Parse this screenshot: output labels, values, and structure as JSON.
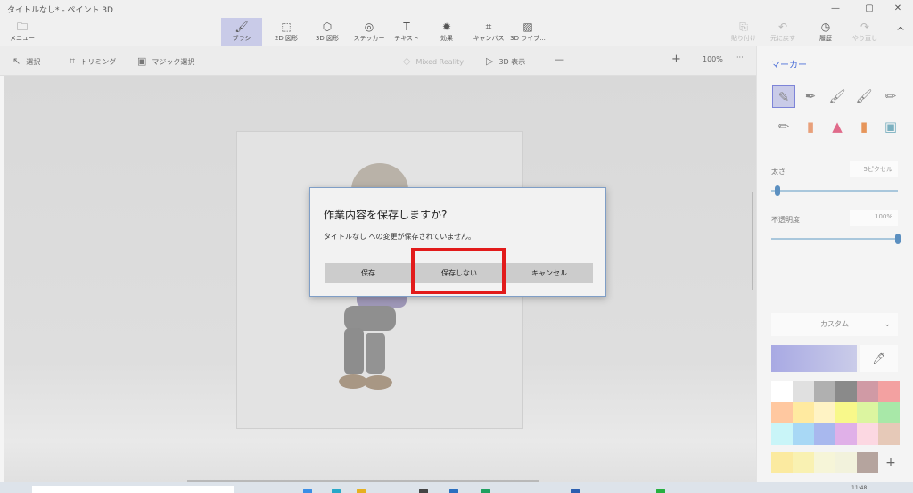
{
  "window": {
    "title": "タイトルなし* - ペイント 3D",
    "minimize": "—",
    "maximize": "▢",
    "close": "✕"
  },
  "ribbon": {
    "menu": {
      "label": "メニュー",
      "icon": "folder-icon"
    },
    "tools": [
      {
        "label": "ブラシ",
        "icon": "brush-icon",
        "active": true
      },
      {
        "label": "2D 図形",
        "icon": "2d-shapes-icon"
      },
      {
        "label": "3D 図形",
        "icon": "3d-shapes-icon"
      },
      {
        "label": "ステッカー",
        "icon": "sticker-icon"
      },
      {
        "label": "テキスト",
        "icon": "text-icon"
      },
      {
        "label": "効果",
        "icon": "effects-icon"
      },
      {
        "label": "キャンバス",
        "icon": "canvas-icon"
      },
      {
        "label": "3D ライブ...",
        "icon": "3d-library-icon"
      }
    ],
    "right": [
      {
        "label": "貼り付け",
        "icon": "paste-icon",
        "enabled": false
      },
      {
        "label": "元に戻す",
        "icon": "undo-icon",
        "enabled": false
      },
      {
        "label": "履歴",
        "icon": "history-icon",
        "enabled": true
      },
      {
        "label": "やり直し",
        "icon": "redo-icon",
        "enabled": false
      }
    ],
    "collapse_icon": "^"
  },
  "toolbar": {
    "select": "選択",
    "crop": "トリミング",
    "magic_select": "マジック選択",
    "mixed_reality": "Mixed Reality",
    "view_3d": "3D 表示",
    "zoom_minus": "—",
    "zoom_plus": "+",
    "zoom": "100%",
    "zoom_level": 0.58,
    "more": "···"
  },
  "panel": {
    "title": "マーカー",
    "thickness_label": "太さ",
    "thickness_value": "5ピクセル",
    "thickness_level": 0.05,
    "opacity_label": "不透明度",
    "opacity_value": "100%",
    "opacity_level": 1.0,
    "color_mode": "カスタム",
    "current_color": "#a8a9e3",
    "palette": [
      "#ffffff",
      "#e0e0e0",
      "#b0b0b0",
      "#8a8a8a",
      "#d09aa5",
      "#f3a1a1",
      "#ffc8a0",
      "#ffeaa0",
      "#fff3c4",
      "#f8f88a",
      "#dcf5a0",
      "#a8e8a8",
      "#c9f5f8",
      "#a8d8f5",
      "#a8b8ee",
      "#e0b0e8",
      "#fcd8e2",
      "#e6c9b8"
    ],
    "recent": [
      "#fbeaa0",
      "#f9f1b2",
      "#f6f5d8",
      "#f2f2dc",
      "#b5a49e"
    ],
    "add": "+"
  },
  "dialog": {
    "title": "作業内容を保存しますか?",
    "message": "タイトルなし への変更が保存されていません。",
    "save": "保存",
    "dont_save": "保存しない",
    "cancel": "キャンセル"
  },
  "taskbar": {
    "clock": "11:48"
  }
}
